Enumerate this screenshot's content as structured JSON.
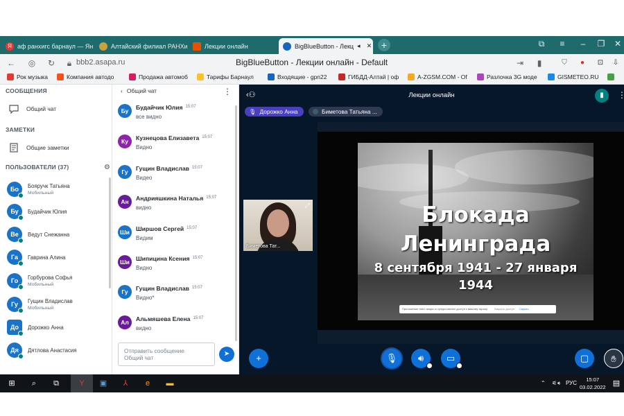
{
  "browser": {
    "tabs": [
      {
        "label": "аф ранхигс барнаул — Ян",
        "icon": "yandex-icon",
        "active": false
      },
      {
        "label": "Алтайский филиал РАНХиГ",
        "icon": "ranepa-icon",
        "active": false
      },
      {
        "label": "Лекции онлайн",
        "icon": "bbb-icon",
        "active": false
      },
      {
        "label": "BigBlueButton - Лекц",
        "icon": "bbb-icon",
        "active": true
      }
    ],
    "url": "bbb2.asapa.ru",
    "page_title": "BigBlueButton - Лекции онлайн - Default",
    "bookmarks": [
      {
        "label": "Рок музыка",
        "color": "#e53935"
      },
      {
        "label": "Компания автодо",
        "color": "#f4511e"
      },
      {
        "label": "Продажа автомоб",
        "color": "#d81b60"
      },
      {
        "label": "Тарифы Барнаул",
        "color": "#fbc02d"
      },
      {
        "label": "Входящие - gpn22",
        "color": "#1565c0"
      },
      {
        "label": "ГИБДД-Алтай | оф",
        "color": "#c62828"
      },
      {
        "label": "A-ZGSM.COM - Of",
        "color": "#f9a825"
      },
      {
        "label": "Разлочка 3G моде",
        "color": "#ab47bc"
      },
      {
        "label": "GISMETEO.RU",
        "color": "#1e88e5"
      }
    ]
  },
  "left_panel": {
    "messages_title": "СООБЩЕНИЯ",
    "public_chat": "Общий чат",
    "notes_title": "ЗАМЕТКИ",
    "shared_notes": "Общие заметки",
    "users_title": "ПОЛЬЗОВАТЕЛИ (37)",
    "users": [
      {
        "initials": "Бо",
        "name": "Бояручк Татьяна",
        "role": "Мобильный",
        "color": "#1a73c7",
        "square": false
      },
      {
        "initials": "Бу",
        "name": "Будайчик Юлия",
        "role": "",
        "color": "#1a73c7",
        "square": false
      },
      {
        "initials": "Ве",
        "name": "Ведут Снежанна",
        "role": "",
        "color": "#1a73c7",
        "square": false
      },
      {
        "initials": "Га",
        "name": "Гаврина Алина",
        "role": "",
        "color": "#1a73c7",
        "square": false
      },
      {
        "initials": "Го",
        "name": "Горбурова Софья",
        "role": "Мобильный",
        "color": "#1a73c7",
        "square": false
      },
      {
        "initials": "Гу",
        "name": "Гущин Владислав",
        "role": "Мобильный",
        "color": "#1a73c7",
        "square": false
      },
      {
        "initials": "До",
        "name": "Дорожко Анна",
        "role": "",
        "color": "#1a73c7",
        "square": true
      },
      {
        "initials": "Дя",
        "name": "Дятлова Анастасия",
        "role": "",
        "color": "#1a73c7",
        "square": false
      }
    ]
  },
  "chat": {
    "header": "Общий чат",
    "messages": [
      {
        "initials": "Бу",
        "name": "Будайчик Юлия",
        "time": "15:07",
        "text": "все видно",
        "color": "#1a73c7"
      },
      {
        "initials": "Ку",
        "name": "Кузнецова Елизавета",
        "time": "15:07",
        "text": "Видно",
        "color": "#8e24aa"
      },
      {
        "initials": "Гу",
        "name": "Гущин Владислав",
        "time": "15:07",
        "text": "Видео",
        "color": "#1a73c7"
      },
      {
        "initials": "Ан",
        "name": "Андрияшкина Наталья",
        "time": "15:07",
        "text": "видно",
        "color": "#6a1b9a"
      },
      {
        "initials": "Ши",
        "name": "Ширшов Сергей",
        "time": "15:07",
        "text": "Видим",
        "color": "#1a73c7"
      },
      {
        "initials": "Ши",
        "name": "Шипицина Ксения",
        "time": "15:07",
        "text": "Видно",
        "color": "#6a1b9a"
      },
      {
        "initials": "Гу",
        "name": "Гущин Владислав",
        "time": "15:07",
        "text": "Видно*",
        "color": "#1a73c7"
      },
      {
        "initials": "Ал",
        "name": "Альмяшева Елена",
        "time": "15:07",
        "text": "видно",
        "color": "#6a1b9a"
      }
    ],
    "input_placeholder_1": "Отправить сообщение",
    "input_placeholder_2": "Общий чат"
  },
  "main": {
    "title": "Лекции онлайн",
    "talkers": [
      {
        "name": "Дорожко Анна",
        "color": "#4a3fbf"
      },
      {
        "name": "Биметова Татьяна ...",
        "color": "#2f3a52"
      }
    ],
    "slide": {
      "line1": "Блокада",
      "line2": "Ленинграда",
      "line3": "8 сентября 1941 - 27 января",
      "line4": "1944"
    },
    "notice": {
      "text": "Приложение bbb2.asapa.ru предоставлен доступ к вашему экрану.",
      "hide": "Закрыть доступ",
      "close": "Скрыть"
    },
    "webcam_label": "Биметова Тат..."
  },
  "taskbar": {
    "lang": "РУС",
    "time": "15:07",
    "date": "03.02.2022"
  }
}
